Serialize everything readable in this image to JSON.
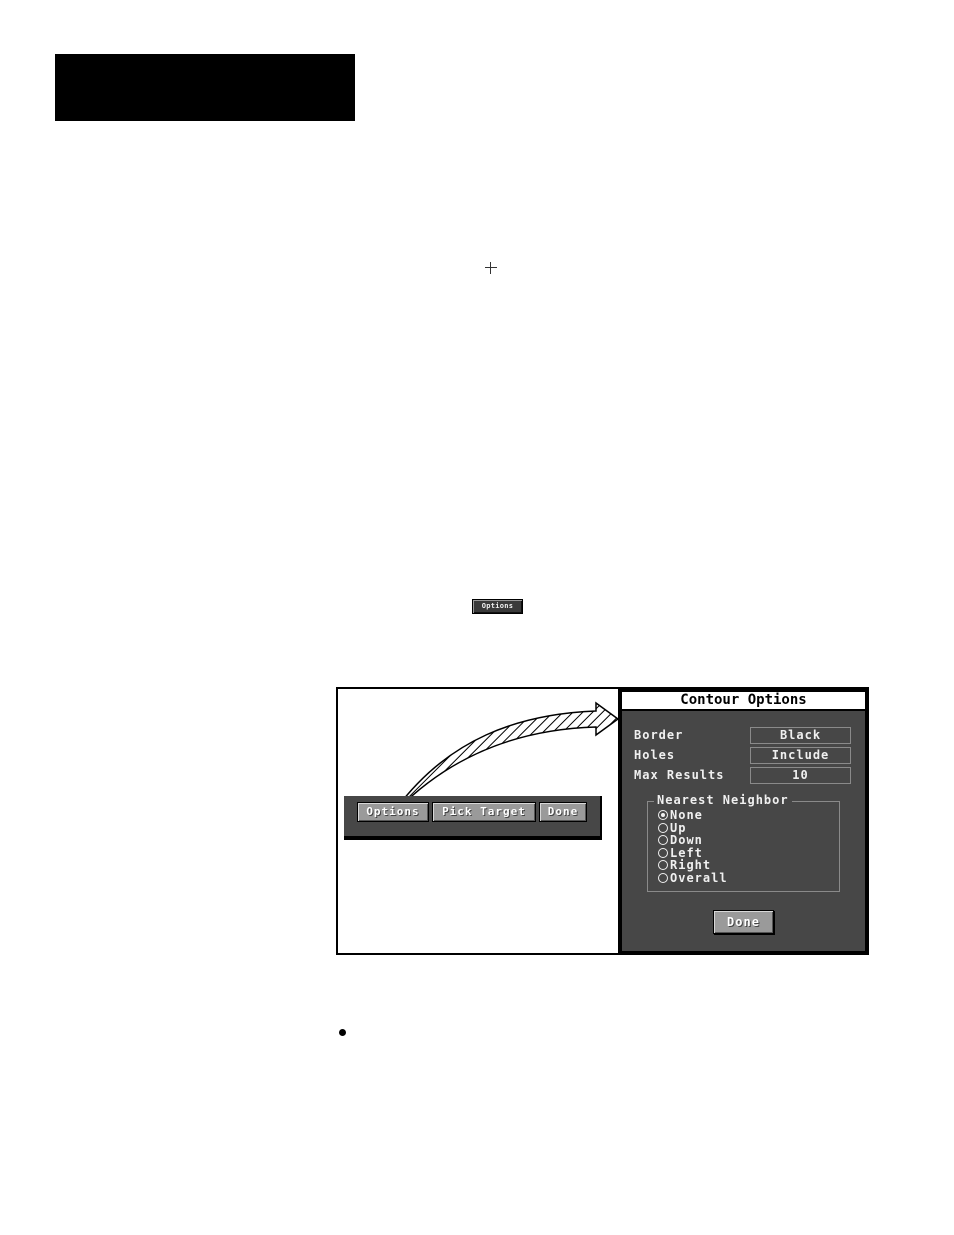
{
  "header": {
    "block_color": "#000000"
  },
  "inline_button": {
    "label": "Options"
  },
  "figure": {
    "button_bar": {
      "buttons": [
        {
          "label": "Options"
        },
        {
          "label": "Pick Target"
        },
        {
          "label": "Done"
        }
      ]
    },
    "dialog": {
      "title": "Contour Options",
      "fields": [
        {
          "label": "Border",
          "value": "Black"
        },
        {
          "label": "Holes",
          "value": "Include"
        },
        {
          "label": "Max Results",
          "value": "10"
        }
      ],
      "nearest_neighbor": {
        "legend": "Nearest Neighbor",
        "options": [
          {
            "label": "None",
            "selected": true
          },
          {
            "label": "Up",
            "selected": false
          },
          {
            "label": "Down",
            "selected": false
          },
          {
            "label": "Left",
            "selected": false
          },
          {
            "label": "Right",
            "selected": false
          },
          {
            "label": "Overall",
            "selected": false
          }
        ]
      },
      "done_label": "Done"
    }
  },
  "colors": {
    "panel_bg": "#474747",
    "button_face": "#9a9a9a",
    "text_light": "#f0f0f0"
  }
}
